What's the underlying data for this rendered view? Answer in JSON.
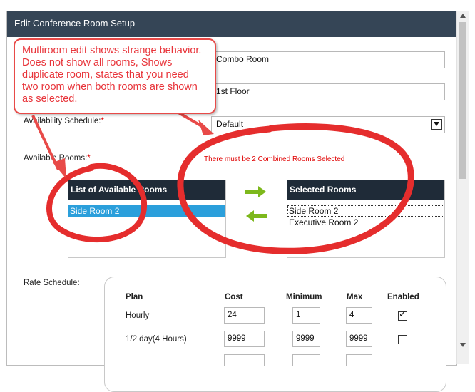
{
  "dialog": {
    "title": "Edit Conference Room Setup"
  },
  "form": {
    "name_value": "Combo Room",
    "location_value": "1st Floor",
    "availability_label": "Availability Schedule:",
    "availability_value": "Default",
    "available_rooms_label": "Available Rooms:",
    "required_mark": "*",
    "validation_error": "There must be 2 Combined Rooms Selected",
    "rate_schedule_label": "Rate Schedule:"
  },
  "rooms": {
    "available_header": "List of Available Rooms",
    "available_items": [
      "Side Room 2"
    ],
    "selected_header": "Selected Rooms",
    "selected_items": [
      "Side Room 2",
      "Executive Room 2"
    ]
  },
  "rate_table": {
    "headers": [
      "Plan",
      "Cost",
      "Minimum",
      "Max",
      "Enabled"
    ],
    "rows": [
      {
        "plan": "Hourly",
        "cost": "24",
        "minimum": "1",
        "max": "4",
        "enabled": true
      },
      {
        "plan": "1/2 day(4 Hours)",
        "cost": "9999",
        "minimum": "9999",
        "max": "9999",
        "enabled": false
      }
    ]
  },
  "annotation": {
    "text": "Mutliroom edit shows strange behavior. Does not show all rooms, Shows duplicate room, states that you need two room when both rooms are shown as selected."
  },
  "colors": {
    "titlebar": "#354556",
    "list_header": "#1f2b38",
    "selection": "#2b9fdb",
    "annotation_red": "#e8343a",
    "arrow_green": "#7db81c"
  }
}
